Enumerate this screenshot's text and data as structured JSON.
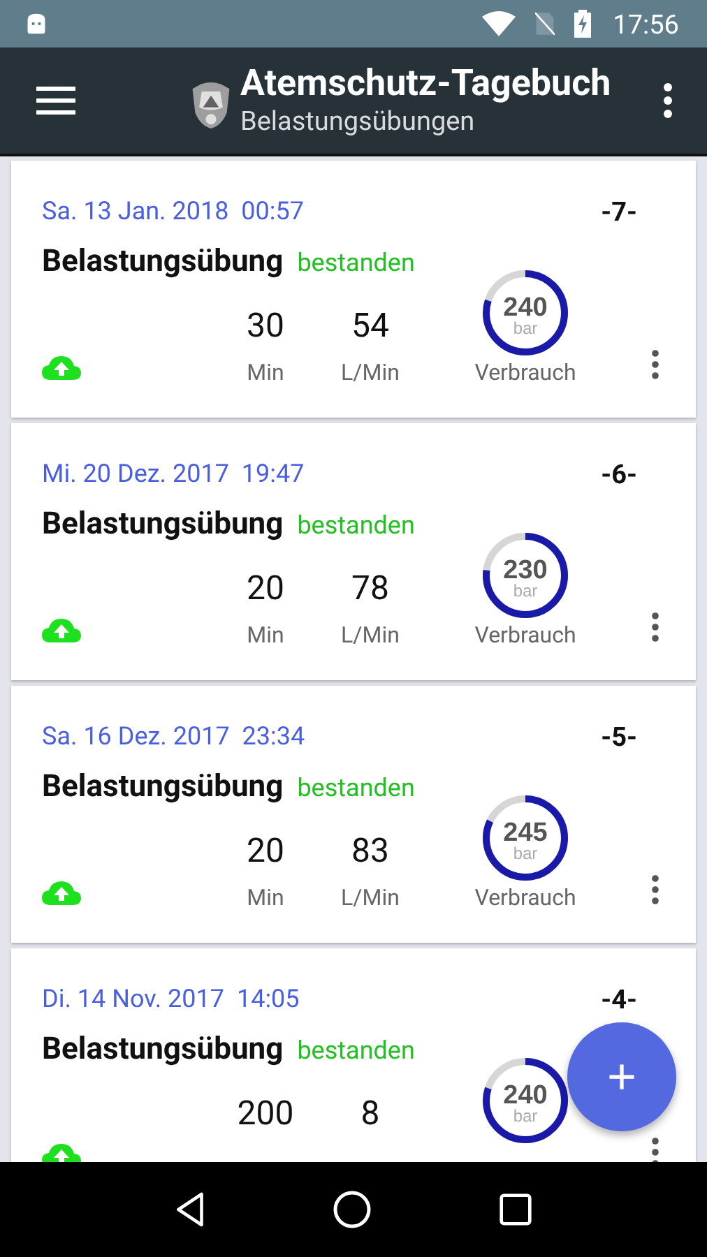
{
  "status_bar": {
    "time": "17:56"
  },
  "app_bar": {
    "title": "Atemschutz-Tagebuch",
    "subtitle": "Belastungsübungen"
  },
  "entries": [
    {
      "date": "Sa. 13 Jan. 2018  00:57",
      "number": "-7-",
      "title": "Belastungsübung",
      "result": "bestanden",
      "duration": "30",
      "duration_unit": "Min",
      "flow": "54",
      "flow_unit": "L/Min",
      "pressure": "240",
      "pressure_unit": "bar",
      "level": 0.8,
      "consumption_label": "Verbrauch",
      "synced": true
    },
    {
      "date": "Mi. 20 Dez. 2017  19:47",
      "number": "-6-",
      "title": "Belastungsübung",
      "result": "bestanden",
      "duration": "20",
      "duration_unit": "Min",
      "flow": "78",
      "flow_unit": "L/Min",
      "pressure": "230",
      "pressure_unit": "bar",
      "level": 0.77,
      "consumption_label": "Verbrauch",
      "synced": true
    },
    {
      "date": "Sa. 16 Dez. 2017  23:34",
      "number": "-5-",
      "title": "Belastungsübung",
      "result": "bestanden",
      "duration": "20",
      "duration_unit": "Min",
      "flow": "83",
      "flow_unit": "L/Min",
      "pressure": "245",
      "pressure_unit": "bar",
      "level": 0.82,
      "consumption_label": "Verbrauch",
      "synced": true
    },
    {
      "date": "Di. 14 Nov. 2017  14:05",
      "number": "-4-",
      "title": "Belastungsübung",
      "result": "bestanden",
      "duration": "200",
      "flow": "8",
      "pressure": "240",
      "pressure_unit": "bar",
      "level": 0.8,
      "synced": true
    }
  ],
  "fab": {
    "label": "+"
  }
}
